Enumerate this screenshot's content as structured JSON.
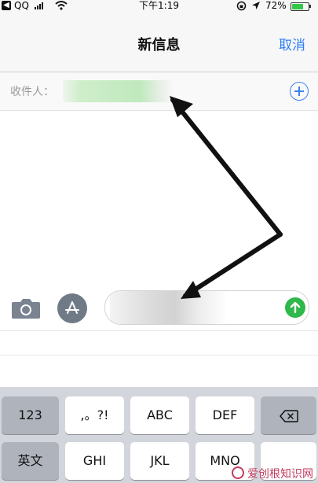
{
  "status_bar": {
    "carrier": "QQ",
    "time": "下午1:19",
    "battery": "72%",
    "battery_level": 0.72
  },
  "nav": {
    "title": "新信息",
    "cancel_label": "取消"
  },
  "recipient": {
    "label": "收件人："
  },
  "colors": {
    "accent": "#2e7df6",
    "send": "#2fb84b",
    "battery": "#35c64a",
    "arrow": "#111111"
  },
  "keyboard": {
    "row1": [
      "123",
      ",。?!",
      "ABC",
      "DEF"
    ],
    "row2": [
      "英文",
      "GHI",
      "JKL",
      "MNO"
    ],
    "delete_icon": "backspace-icon"
  },
  "watermark": {
    "text": "爱创根知识网"
  }
}
